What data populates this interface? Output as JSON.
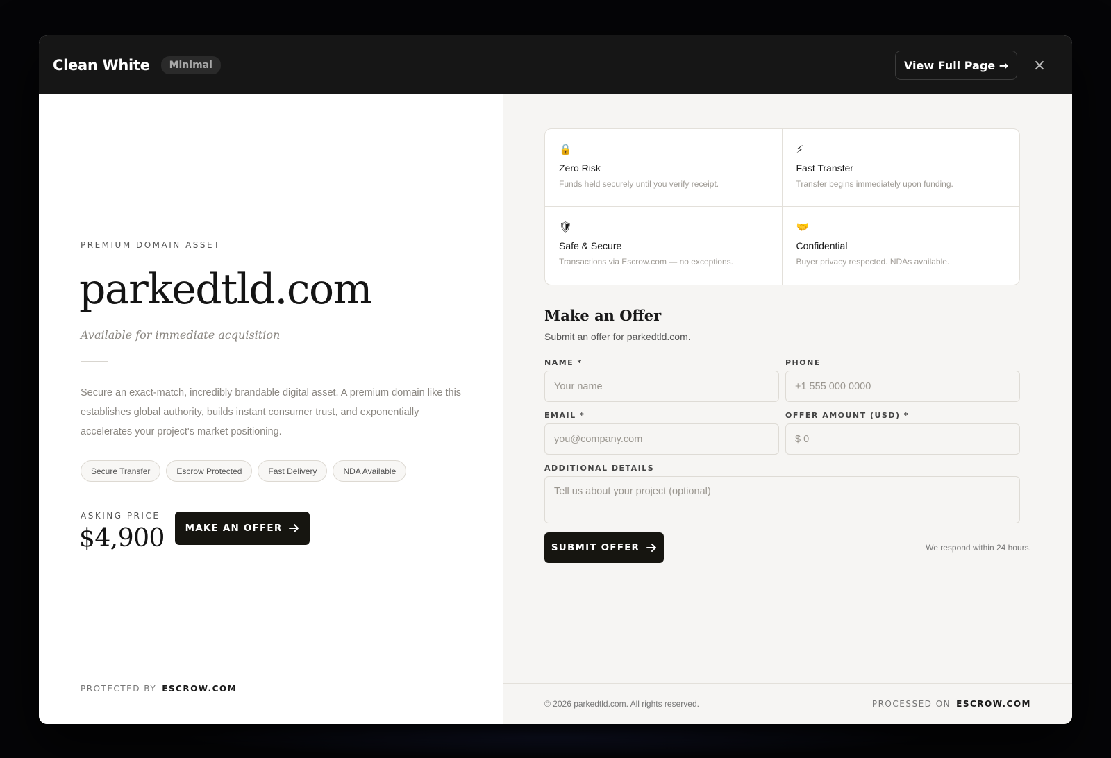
{
  "header": {
    "title": "Clean White",
    "badge": "Minimal",
    "view_full_label": "View Full Page →",
    "close_symbol": "×"
  },
  "left": {
    "eyebrow": "PREMIUM DOMAIN ASSET",
    "domain": "parkedtld.com",
    "subtitle": "Available for immediate acquisition",
    "description": "Secure an exact-match, incredibly brandable digital asset. A premium domain like this establishes global authority, builds instant consumer trust, and exponentially accelerates your project's market positioning.",
    "tags": [
      "Secure Transfer",
      "Escrow Protected",
      "Fast Delivery",
      "NDA Available"
    ],
    "asking_label": "ASKING PRICE",
    "asking_price": "$4,900",
    "make_offer_label": "MAKE AN OFFER",
    "protected_label": "PROTECTED BY",
    "protected_brand": "ESCROW.COM"
  },
  "features": [
    {
      "icon": "lock-icon",
      "glyph": "🔒",
      "title": "Zero Risk",
      "desc": "Funds held securely until you verify receipt."
    },
    {
      "icon": "lightning-icon",
      "glyph": "⚡",
      "title": "Fast Transfer",
      "desc": "Transfer begins immediately upon funding."
    },
    {
      "icon": "shield-icon",
      "glyph": "🛡",
      "title": "Safe & Secure",
      "desc": "Transactions via Escrow.com — no exceptions."
    },
    {
      "icon": "handshake-icon",
      "glyph": "🤝",
      "title": "Confidential",
      "desc": "Buyer privacy respected. NDAs available."
    }
  ],
  "form": {
    "title": "Make an Offer",
    "subtitle": "Submit an offer for parkedtld.com.",
    "name_label": "NAME *",
    "name_placeholder": "Your name",
    "phone_label": "PHONE",
    "phone_placeholder": "+1 555 000 0000",
    "email_label": "EMAIL *",
    "email_placeholder": "you@company.com",
    "amount_label": "OFFER AMOUNT (USD) *",
    "amount_placeholder": "$ 0",
    "details_label": "ADDITIONAL DETAILS",
    "details_placeholder": "Tell us about your project (optional)",
    "submit_label": "SUBMIT OFFER",
    "respond_note": "We respond within 24 hours."
  },
  "footer": {
    "copyright": "© 2026 parkedtld.com. All rights reserved.",
    "processed_label": "PROCESSED ON",
    "processed_brand": "ESCROW.COM"
  }
}
